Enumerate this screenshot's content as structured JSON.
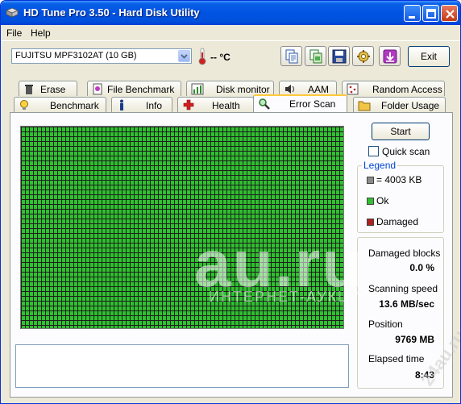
{
  "window": {
    "title": "HD Tune Pro 3.50 - Hard Disk Utility"
  },
  "menu": {
    "file": "File",
    "help": "Help"
  },
  "toolbar": {
    "drive": "FUJITSU MPF3102AT (10 GB)",
    "temperature": "-- °C",
    "exit_label": "Exit",
    "icons": [
      "copy-text-icon",
      "copy-screenshot-icon",
      "save-icon",
      "options-icon",
      "download-icon"
    ]
  },
  "tabs": {
    "row_top": [
      "Erase",
      "File Benchmark",
      "Disk monitor",
      "AAM",
      "Random Access"
    ],
    "row_bottom": [
      "Benchmark",
      "Info",
      "Health",
      "Error Scan",
      "Folder Usage"
    ],
    "active": "Error Scan"
  },
  "scan": {
    "start_label": "Start",
    "quick_scan_label": "Quick scan",
    "quick_scan_checked": false,
    "legend_title": "Legend",
    "legend_items": [
      {
        "label": "= 4003 KB",
        "color": "#8a8a8a"
      },
      {
        "label": "Ok",
        "color": "#2fc12f"
      },
      {
        "label": "Damaged",
        "color": "#b02020"
      }
    ],
    "stats": {
      "damaged_blocks_label": "Damaged blocks",
      "damaged_blocks_value": "0.0 %",
      "scanning_speed_label": "Scanning speed",
      "scanning_speed_value": "13.6 MB/sec",
      "position_label": "Position",
      "position_value": "9769 MB",
      "elapsed_time_label": "Elapsed time",
      "elapsed_time_value": "8:43"
    }
  },
  "watermark": {
    "main": "au.ru",
    "sub": "ИНТЕРНЕТ-АУКЦИОН",
    "corner": "24au.ru"
  }
}
